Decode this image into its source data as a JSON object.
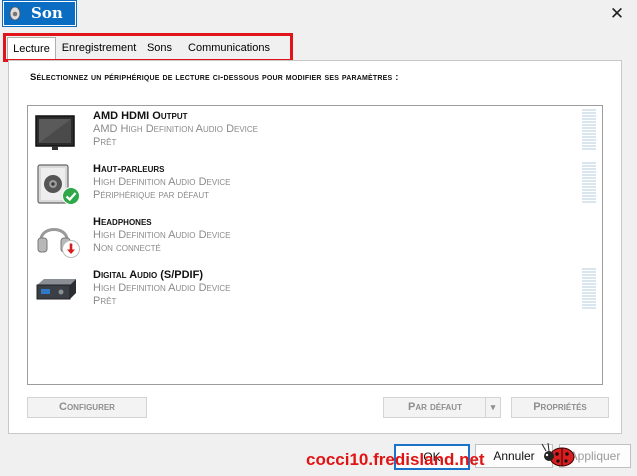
{
  "window": {
    "title": "Son",
    "close_glyph": "✕"
  },
  "tabs": [
    {
      "label": "Lecture",
      "active": true
    },
    {
      "label": "Enregistrement",
      "active": false
    },
    {
      "label": "Sons",
      "active": false
    },
    {
      "label": "Communications",
      "active": false
    }
  ],
  "main": {
    "heading": "Sélectionnez un périphérique de lecture ci-dessous pour modifier ses paramètres :",
    "devices": [
      {
        "name": "AMD HDMI Output",
        "description": "AMD High Definition Audio Device",
        "status": "Prêt",
        "icon": "monitor-icon",
        "meter": true
      },
      {
        "name": "Haut-parleurs",
        "description": "High Definition Audio Device",
        "status": "Périphérique par défaut",
        "icon": "speaker-icon",
        "badge": "check-badge-icon",
        "meter": true
      },
      {
        "name": "Headphones",
        "description": "High Definition Audio Device",
        "status": "Non connecté",
        "icon": "headphones-icon",
        "badge": "disconnected-badge-icon",
        "meter": false
      },
      {
        "name": "Digital Audio (S/PDIF)",
        "description": "High Definition Audio Device",
        "status": "Prêt",
        "icon": "spdif-device-icon",
        "meter": true
      }
    ]
  },
  "actions": {
    "configure": "Configurer",
    "set_default": "Par défaut",
    "properties": "Propriétés"
  },
  "footer": {
    "ok": "OK",
    "cancel": "Annuler",
    "apply": "Appliquer",
    "watermark": "cocci10.fredisland.net"
  },
  "colors": {
    "accent": "#0a6dc2",
    "highlight": "#e1141c",
    "check": "#2fa84a"
  }
}
